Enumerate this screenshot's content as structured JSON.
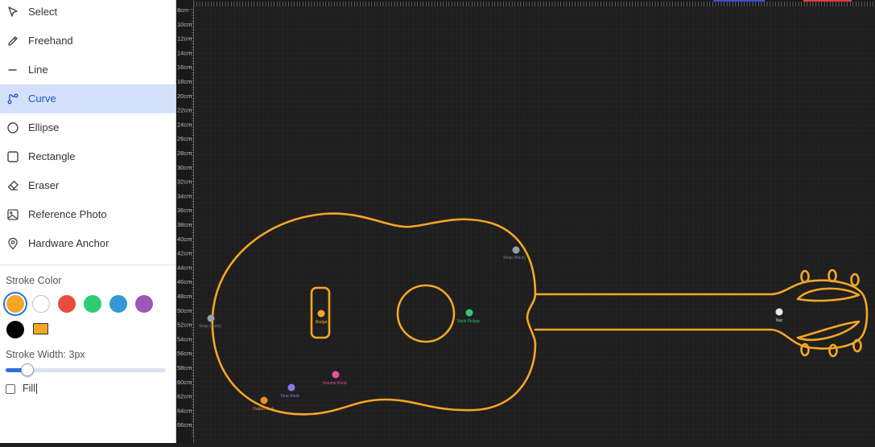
{
  "tools": [
    {
      "label": "Select",
      "icon": "pointer-icon",
      "active": false
    },
    {
      "label": "Freehand",
      "icon": "pencil-icon",
      "active": false
    },
    {
      "label": "Line",
      "icon": "line-icon",
      "active": false
    },
    {
      "label": "Curve",
      "icon": "curve-icon",
      "active": true
    },
    {
      "label": "Ellipse",
      "icon": "ellipse-icon",
      "active": false
    },
    {
      "label": "Rectangle",
      "icon": "rectangle-icon",
      "active": false
    },
    {
      "label": "Eraser",
      "icon": "eraser-icon",
      "active": false
    },
    {
      "label": "Reference Photo",
      "icon": "image-icon",
      "active": false
    },
    {
      "label": "Hardware Anchor",
      "icon": "map-pin-icon",
      "active": false
    }
  ],
  "stroke_color": {
    "label": "Stroke Color",
    "selected": "#f5a623",
    "swatches": [
      "#f5a623",
      "#ffffff",
      "#e74c3c",
      "#2ecc71",
      "#3498db",
      "#9b59b6",
      "#000000"
    ],
    "fill_swatch": "#f5a623"
  },
  "stroke_width": {
    "label": "Stroke Width: 3px",
    "value": 3,
    "fraction": 0.13
  },
  "fill": {
    "label": "Fill",
    "checked": false
  },
  "ruler": {
    "unit": "cm",
    "labels": [
      "8cm",
      "10cm",
      "12cm",
      "14cm",
      "16cm",
      "18cm",
      "20cm",
      "22cm",
      "24cm",
      "26cm",
      "28cm",
      "30cm",
      "32cm",
      "34cm",
      "36cm",
      "38cm",
      "40cm",
      "42cm",
      "44cm",
      "46cm",
      "48cm",
      "50cm",
      "52cm",
      "54cm",
      "56cm",
      "58cm",
      "60cm",
      "62cm",
      "64cm",
      "66cm"
    ]
  },
  "anchors": [
    {
      "name": "Strap (Neck)",
      "color": "#9aa0a6"
    },
    {
      "name": "Strap (Body)",
      "color": "#9aa0a6"
    },
    {
      "name": "Bridge",
      "color": "#f5a623"
    },
    {
      "name": "Neck Pickup",
      "color": "#2ecc71"
    },
    {
      "name": "Nut",
      "color": "#e8e8e8"
    },
    {
      "name": "Volume Knob",
      "color": "#e056a0"
    },
    {
      "name": "Tone Knob",
      "color": "#8c7ae6"
    },
    {
      "name": "Output Jack",
      "color": "#f08c2a"
    }
  ],
  "drawing_color": "#f5a623"
}
